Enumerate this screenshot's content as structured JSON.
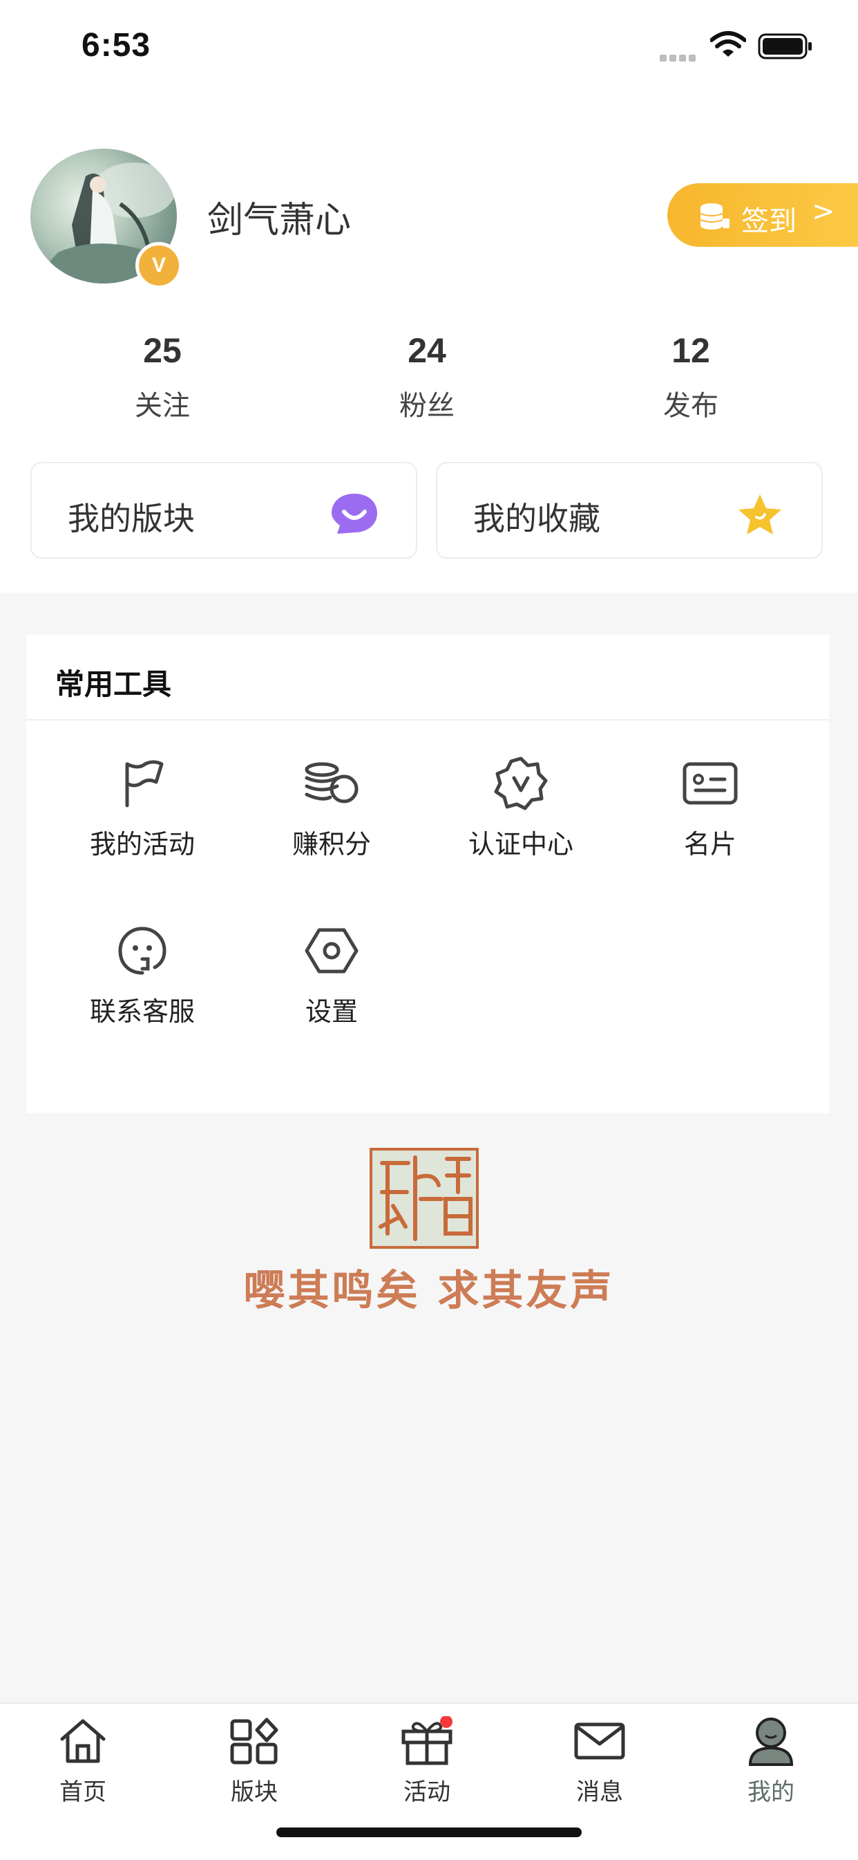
{
  "status_bar": {
    "time": "6:53"
  },
  "profile": {
    "username": "剑气萧心",
    "badge": "V",
    "signin_label": "签到",
    "signin_arrow": ">"
  },
  "stats": [
    {
      "value": "25",
      "label": "关注"
    },
    {
      "value": "24",
      "label": "粉丝"
    },
    {
      "value": "12",
      "label": "发布"
    }
  ],
  "cards": {
    "my_boards": {
      "label": "我的版块",
      "icon": "smile-chat-icon",
      "color": "#9b6cf0"
    },
    "my_favorites": {
      "label": "我的收藏",
      "icon": "star-icon",
      "color": "#f6c22e"
    }
  },
  "tools": {
    "title": "常用工具",
    "items": [
      {
        "label": "我的活动",
        "icon": "flag-icon"
      },
      {
        "label": "赚积分",
        "icon": "coins-icon"
      },
      {
        "label": "认证中心",
        "icon": "verified-badge-icon"
      },
      {
        "label": "名片",
        "icon": "id-card-icon"
      },
      {
        "label": "联系客服",
        "icon": "customer-service-icon"
      },
      {
        "label": "设置",
        "icon": "settings-hex-icon"
      }
    ]
  },
  "footer": {
    "seal_icon": "seal-stamp-icon",
    "slogan": "嘤其鸣矣 求其友声",
    "slogan_color": "#c96f44"
  },
  "tabbar": {
    "items": [
      {
        "label": "首页",
        "icon": "home-icon"
      },
      {
        "label": "版块",
        "icon": "grid-icon"
      },
      {
        "label": "活动",
        "icon": "gift-icon",
        "has_dot": true
      },
      {
        "label": "消息",
        "icon": "mail-icon"
      },
      {
        "label": "我的",
        "icon": "user-icon",
        "active": true
      }
    ],
    "active_color": "#5e6e66",
    "dot_color": "#f23a3a"
  }
}
